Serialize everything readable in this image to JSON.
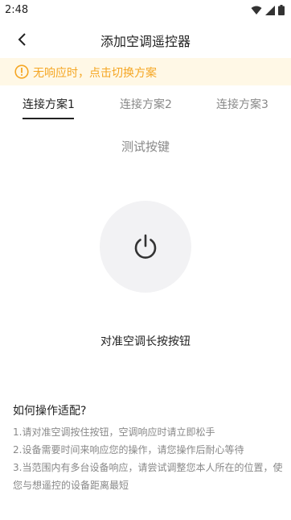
{
  "status_bar": {
    "time": "2:48"
  },
  "header": {
    "title": "添加空调遥控器"
  },
  "banner": {
    "text": "无响应时，点击切换方案",
    "color": "#f5a623"
  },
  "tabs": [
    {
      "label": "连接方案1",
      "active": true
    },
    {
      "label": "连接方案2",
      "active": false
    },
    {
      "label": "连接方案3",
      "active": false
    }
  ],
  "test_label": "测试按键",
  "power_button": {
    "icon": "power-icon"
  },
  "instruction": "对准空调长按按钮",
  "help": {
    "title": "如何操作适配?",
    "items": [
      "1.请对准空调按住按钮，空调响应时请立即松手",
      "2.设备需要时间来响应您的操作，请您操作后耐心等待",
      "3.当范围内有多台设备响应，请尝试调整您本人所在的位置，使您与想遥控的设备距离最短"
    ]
  }
}
